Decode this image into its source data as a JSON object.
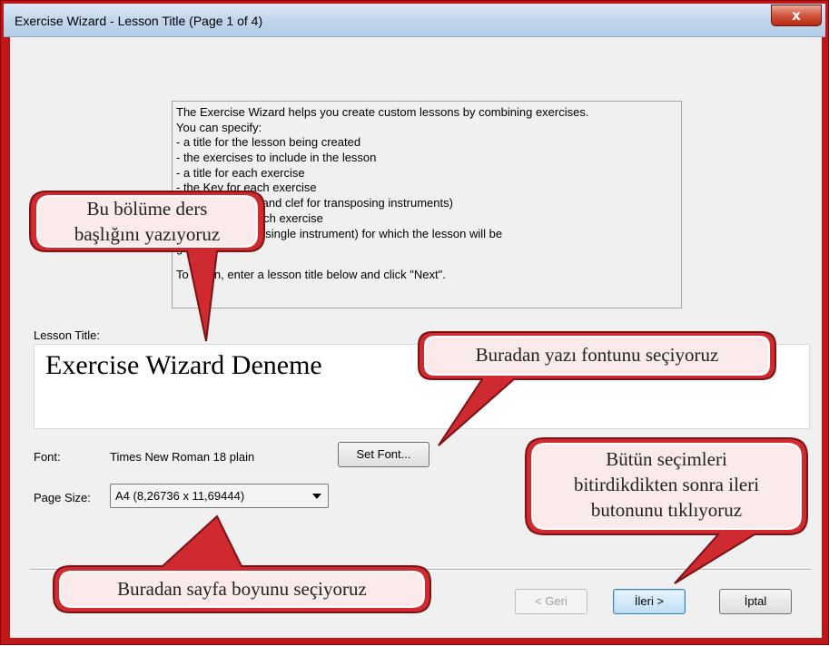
{
  "window": {
    "title": "Exercise Wizard - Lesson Title (Page 1 of 4)",
    "close_glyph": "x"
  },
  "intro": {
    "lines": [
      "The Exercise Wizard helps you create custom lessons by combining exercises.",
      "You can specify:",
      "- a title for the lesson being created",
      "- the exercises to include in the lesson",
      "- a title for each exercise",
      "- the Key for each exercise",
      "- the proper key and clef for transposing instruments)",
      "- n pattern for each exercise",
      "- instruments (or single instrument) for which the lesson will be",
      "generated",
      "To begin, enter a lesson title below and click \"Next\"."
    ]
  },
  "form": {
    "lesson_title_label": "Lesson Title:",
    "lesson_title_value": "Exercise Wizard Deneme",
    "font_label": "Font:",
    "font_value": "Times New Roman 18 plain",
    "set_font_label": "Set Font...",
    "page_size_label": "Page Size:",
    "page_size_value": "A4 (8,26736 x 11,69444)"
  },
  "buttons": {
    "back": "< Geri",
    "next": "İleri >",
    "cancel": "İptal"
  },
  "callouts": {
    "lesson_title": [
      "Bu bölüme ders",
      "başlığını yazıyoruz"
    ],
    "font": [
      "Buradan yazı fontunu seçiyoruz"
    ],
    "next": [
      "Bütün seçimleri",
      "bitirdikdikten sonra ileri",
      "butonunu tıklıyoruz"
    ],
    "page_size": [
      "Buradan sayfa boyunu seçiyoruz"
    ]
  },
  "colors": {
    "callout_fill": "#cf2a2f",
    "callout_inner": "#ffffff",
    "frame": "#c0161a"
  }
}
